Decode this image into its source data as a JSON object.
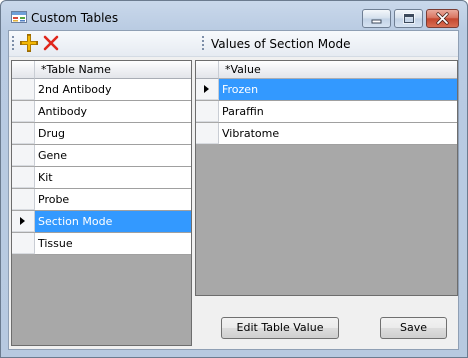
{
  "window": {
    "title": "Custom Tables",
    "icon": "custom-tables-app-icon",
    "controls": [
      "minimize-icon",
      "maximize-icon",
      "close-icon"
    ]
  },
  "toolbar": {
    "add_icon": "plus-icon",
    "delete_icon": "red-x-icon"
  },
  "right_header": {
    "label": "Values of Section Mode"
  },
  "table_names": {
    "column_header": "*Table Name",
    "rows": [
      "2nd Antibody",
      "Antibody",
      "Drug",
      "Gene",
      "Kit",
      "Probe",
      "Section Mode",
      "Tissue"
    ],
    "selected_index": 6
  },
  "values": {
    "column_header": "*Value",
    "rows": [
      "Frozen",
      "Paraffin",
      "Vibratome"
    ],
    "selected_index": 0
  },
  "buttons": {
    "edit_table_value": "Edit Table Value",
    "save": "Save"
  },
  "colors": {
    "selection": "#3399ff",
    "close_button": "#c4472f",
    "add_icon": "#e8a400",
    "delete_icon": "#e0261b"
  }
}
